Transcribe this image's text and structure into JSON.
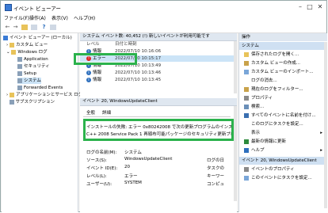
{
  "window": {
    "title": "イベント ビューアー"
  },
  "menu": [
    "ファイル(F)",
    "操作(A)",
    "表示(V)",
    "ヘルプ(H)"
  ],
  "tree": {
    "root": "イベント ビューアー (ローカル)",
    "custom": "カスタム ビュー",
    "winlogs": "Windows ログ",
    "application": "Application",
    "security": "セキュリティ",
    "setup": "Setup",
    "system": "システム",
    "forwarded": "Forwarded Events",
    "appservice": "アプリケーションとサービス ログ",
    "subscription": "サブスクリプション"
  },
  "list": {
    "header": "システム   イベント数: 40,452 (!) 新しいイベントが利用可能です",
    "col_level": "レベル",
    "col_date": "日付と時刻",
    "rows": [
      {
        "level": "情報",
        "date": "2022/07/10 10:16:06",
        "icon": "info"
      },
      {
        "level": "エラー",
        "date": "2022/07/10 10:15:17",
        "icon": "error"
      },
      {
        "level": "情報",
        "date": "2022/07/10 10:13:49",
        "icon": "info"
      },
      {
        "level": "情報",
        "date": "2022/07/10 10:13:46",
        "icon": "info"
      },
      {
        "level": "情報",
        "date": "2022/07/10 10:13:45",
        "icon": "info"
      }
    ]
  },
  "detail": {
    "title": "イベント 20, WindowsUpdateClient",
    "tab_general": "全般",
    "tab_details": "詳細",
    "message_line1": "インストールの失敗: エラー 0x80242008 で次の更新プログラムのインスト",
    "message_line2": "C++ 2008 Service Pack 1 再頒布可能パッケージのセキュリティ更新プロ",
    "log_name_label": "ログの名前(M):",
    "log_name_value": "システム",
    "source_label": "ソース(S):",
    "source_value": "WindowsUpdateClient",
    "source_right": "ログの日",
    "event_id_label": "イベント ID(E):",
    "event_id_value": "20",
    "event_id_right": "タスクの",
    "level_label": "レベル(L):",
    "level_value": "エラー",
    "level_right": "キーワー",
    "user_label": "ユーザー(U):",
    "user_value": "SYSTEM",
    "user_right": "コンピュ"
  },
  "actions": {
    "header": "操作",
    "system_header": "システム",
    "items": [
      "保存されたログを開く...",
      "カスタム ビューの作成...",
      "カスタム ビューのインポート...",
      "ログの消去...",
      "現在のログをフィルター...",
      "プロパティ",
      "検索...",
      "すべてのイベントに名前を付け...",
      "このログにタスクを設定...",
      "表示",
      "最新の情報に更新",
      "ヘルプ"
    ],
    "event_header": "イベント 20, WindowsUpdateClient",
    "event_items": [
      "イベントのプロパティ",
      "このイベントにタスクを設定..."
    ]
  }
}
